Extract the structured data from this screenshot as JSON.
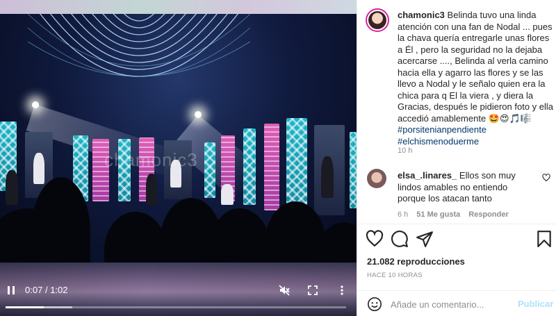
{
  "video": {
    "watermark": "chamonic3",
    "current_time": "0:07",
    "separator": "/",
    "duration": "1:02",
    "progress_fraction": 0.113,
    "buffered_fraction": 0.196,
    "icons": {
      "play_pause": "pause-icon",
      "mute": "volume-muted-icon",
      "fullscreen": "fullscreen-icon",
      "more": "more-vertical-icon"
    }
  },
  "post": {
    "author": "chamonic3",
    "caption": "Belinda tuvo una linda atención con una fan de Nodal ... pues la chava quería entregarle unas flores a Él , pero la seguridad no la dejaba acercarse ...., Belinda al verla camino hacia ella y agarro las flores y se las llevo a Nodal y le señalo quien era la chica para q El la viera , y diera la Gracias, después le pidieron foto y ella accedió amablemente",
    "caption_emojis": "🤩😍🎵🎼",
    "hashtags": [
      "#porsitenianpendiente",
      "#elchismenoduerme"
    ],
    "time_ago": "10 h"
  },
  "comment": {
    "author": "elsa_.linares_",
    "text": "Ellos son muy lindos amables no entiendo porque los atacan tanto",
    "time_ago": "6 h",
    "likes": "51 Me gusta",
    "reply_label": "Responder"
  },
  "stats": {
    "views": "21.082 reproducciones",
    "posted": "HACE 10 HORAS"
  },
  "composer": {
    "placeholder": "Añade un comentario...",
    "publish_label": "Publicar"
  },
  "colors": {
    "hashtag": "#00376b",
    "publish_disabled": "#b2dffc",
    "muted_text": "#8e8e8e",
    "avatar_ring": "#d6249f"
  }
}
